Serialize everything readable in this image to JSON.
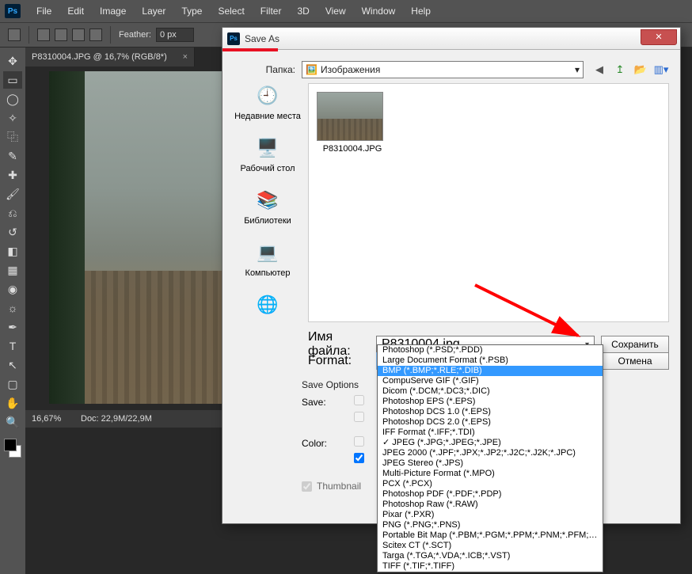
{
  "menubar": [
    "File",
    "Edit",
    "Image",
    "Layer",
    "Type",
    "Select",
    "Filter",
    "3D",
    "View",
    "Window",
    "Help"
  ],
  "options": {
    "feather_label": "Feather:",
    "feather_value": "0 px"
  },
  "doc_tab": "P8310004.JPG @ 16,7% (RGB/8*)",
  "status": {
    "zoom": "16,67%",
    "doc": "Doc: 22,9M/22,9M"
  },
  "dialog": {
    "title": "Save As",
    "folder_label": "Папка:",
    "folder_value": "Изображения",
    "sidebar": [
      {
        "icon": "🕘",
        "label": "Недавние места"
      },
      {
        "icon": "🖥️",
        "label": "Рабочий стол"
      },
      {
        "icon": "📚",
        "label": "Библиотеки"
      },
      {
        "icon": "💻",
        "label": "Компьютер"
      },
      {
        "icon": "🌐",
        "label": ""
      }
    ],
    "thumb_name": "P8310004.JPG",
    "filename_label": "Имя файла:",
    "filename_value": "P8310004.jpg",
    "format_label": "Format:",
    "format_value": "JPEG (*.JPG;*.JPEG;*.JPE)",
    "save_btn": "Сохранить",
    "cancel_btn": "Отмена",
    "save_options_title": "Save Options",
    "save_label": "Save:",
    "color_label": "Color:",
    "thumbnail_cb": "Thumbnail",
    "format_list": [
      "Photoshop (*.PSD;*.PDD)",
      "Large Document Format (*.PSB)",
      "BMP (*.BMP;*.RLE;*.DIB)",
      "CompuServe GIF (*.GIF)",
      "Dicom (*.DCM;*.DC3;*.DIC)",
      "Photoshop EPS (*.EPS)",
      "Photoshop DCS 1.0 (*.EPS)",
      "Photoshop DCS 2.0 (*.EPS)",
      "IFF Format (*.IFF;*.TDI)",
      "JPEG (*.JPG;*.JPEG;*.JPE)",
      "JPEG 2000 (*.JPF;*.JPX;*.JP2;*.J2C;*.J2K;*.JPC)",
      "JPEG Stereo (*.JPS)",
      "Multi-Picture Format (*.MPO)",
      "PCX (*.PCX)",
      "Photoshop PDF (*.PDF;*.PDP)",
      "Photoshop Raw (*.RAW)",
      "Pixar (*.PXR)",
      "PNG (*.PNG;*.PNS)",
      "Portable Bit Map (*.PBM;*.PGM;*.PPM;*.PNM;*.PFM;*.PAM)",
      "Scitex CT (*.SCT)",
      "Targa (*.TGA;*.VDA;*.ICB;*.VST)",
      "TIFF (*.TIF;*.TIFF)"
    ],
    "format_highlight_index": 2,
    "format_checked_index": 9
  }
}
